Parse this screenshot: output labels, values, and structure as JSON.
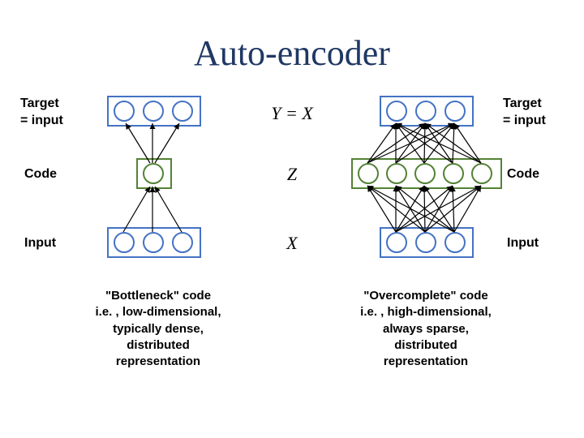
{
  "title": "Auto-encoder",
  "labels": {
    "target_left": "Target\n= input",
    "target_right": "Target\n= input",
    "code_left": "Code",
    "code_right": "Code",
    "input_left": "Input",
    "input_right": "Input"
  },
  "math": {
    "y": "Y = X",
    "z": "Z",
    "x": "X"
  },
  "descriptions": {
    "left": "\"Bottleneck\" code\ni.e. , low-dimensional,\ntypically dense,\ndistributed\nrepresentation",
    "right": "\"Overcomplete\" code\ni.e. , high-dimensional,\nalways sparse,\ndistributed\nrepresentation"
  },
  "diagrams": {
    "left": {
      "input_nodes": 3,
      "code_nodes": 1,
      "target_nodes": 3
    },
    "right": {
      "input_nodes": 3,
      "code_nodes": 5,
      "target_nodes": 3
    }
  }
}
